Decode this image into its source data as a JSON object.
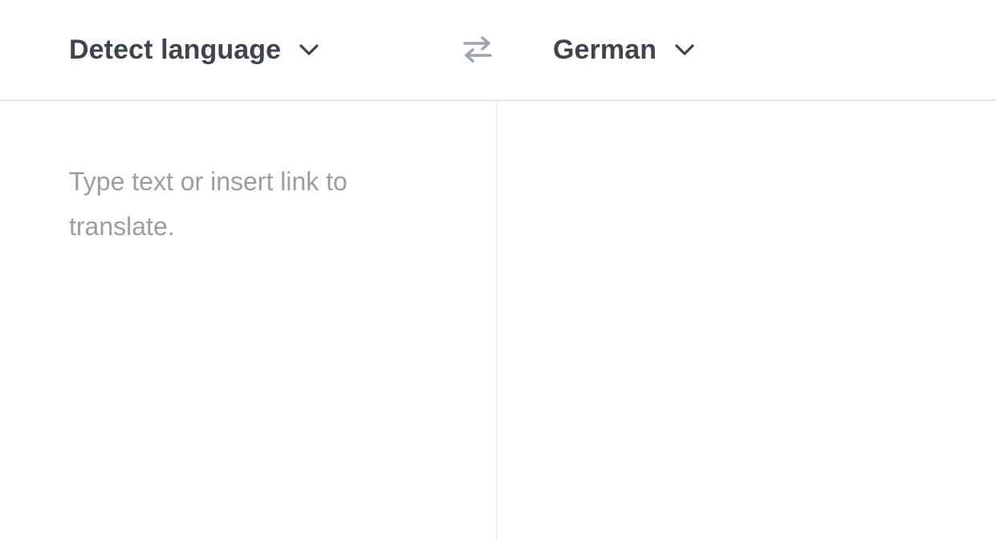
{
  "toolbar": {
    "source_language": "Detect language",
    "target_language": "German"
  },
  "source": {
    "placeholder": "Type text or insert link to translate.",
    "value": ""
  },
  "target": {
    "value": ""
  },
  "icons": {
    "source_dropdown": "chevron-down-icon",
    "swap": "swap-arrows-icon",
    "target_dropdown": "chevron-down-icon"
  },
  "colors": {
    "text": "#3f454d",
    "placeholder": "#9a9ea3",
    "swap_icon": "#9ca3ad",
    "border": "#e4e6e9"
  }
}
